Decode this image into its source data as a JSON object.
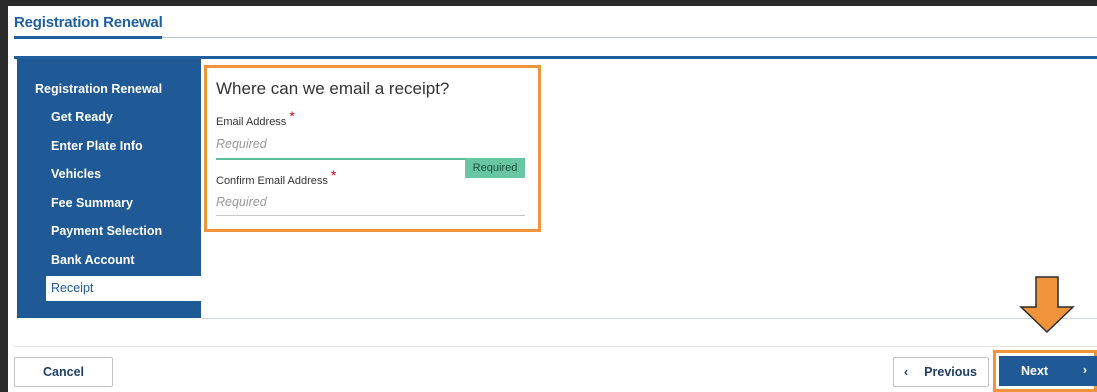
{
  "page": {
    "title": "Registration Renewal"
  },
  "sidebar": {
    "heading": "Registration Renewal",
    "items": [
      {
        "label": "Get Ready",
        "active": false
      },
      {
        "label": "Enter Plate Info",
        "active": false
      },
      {
        "label": "Vehicles",
        "active": false
      },
      {
        "label": "Fee Summary",
        "active": false
      },
      {
        "label": "Payment Selection",
        "active": false
      },
      {
        "label": "Bank Account",
        "active": false
      },
      {
        "label": "Receipt",
        "active": true
      }
    ]
  },
  "form": {
    "heading": "Where can we email a receipt?",
    "email": {
      "label": "Email Address",
      "required_marker": "*",
      "placeholder": "Required",
      "value": ""
    },
    "confirm_email": {
      "label": "Confirm Email Address",
      "required_marker": "*",
      "placeholder": "Required",
      "value": ""
    },
    "validation_badge": "Required"
  },
  "footer": {
    "cancel_label": "Cancel",
    "previous_label": "Previous",
    "previous_icon": "chevron-left-icon",
    "next_label": "Next",
    "next_icon": "chevron-right-icon"
  },
  "annotations": {
    "highlight_color": "#f0943b",
    "arrow_icon": "down-arrow-icon"
  },
  "colors": {
    "brand_blue": "#1f5a96",
    "validation_green": "#68c7a2",
    "required_red": "#d0021b"
  }
}
